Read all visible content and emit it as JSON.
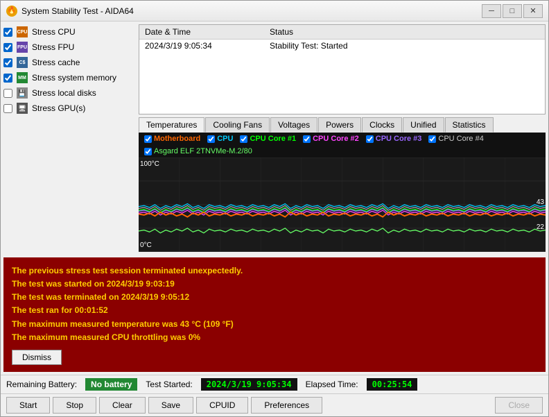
{
  "window": {
    "title": "System Stability Test - AIDA64",
    "icon": "🔥"
  },
  "titlebar": {
    "minimize": "─",
    "maximize": "□",
    "close": "✕"
  },
  "checkboxes": [
    {
      "id": "stress-cpu",
      "label": "Stress CPU",
      "checked": true,
      "iconColor": "#cc6600",
      "iconText": "CPU"
    },
    {
      "id": "stress-fpu",
      "label": "Stress FPU",
      "checked": true,
      "iconColor": "#6644aa",
      "iconText": "FPU"
    },
    {
      "id": "stress-cache",
      "label": "Stress cache",
      "checked": true,
      "iconColor": "#336699",
      "iconText": "C$"
    },
    {
      "id": "stress-mem",
      "label": "Stress system memory",
      "checked": true,
      "iconColor": "#228833",
      "iconText": "MEM"
    },
    {
      "id": "stress-disk",
      "label": "Stress local disks",
      "checked": false,
      "iconColor": "#888",
      "iconText": "💾"
    },
    {
      "id": "stress-gpu",
      "label": "Stress GPU(s)",
      "checked": false,
      "iconColor": "#555",
      "iconText": "GPU"
    }
  ],
  "log": {
    "headers": [
      "Date & Time",
      "Status"
    ],
    "rows": [
      {
        "datetime": "2024/3/19 9:05:34",
        "status": "Stability Test: Started"
      }
    ]
  },
  "tabs": [
    {
      "id": "temperatures",
      "label": "Temperatures",
      "active": true
    },
    {
      "id": "cooling-fans",
      "label": "Cooling Fans",
      "active": false
    },
    {
      "id": "voltages",
      "label": "Voltages",
      "active": false
    },
    {
      "id": "powers",
      "label": "Powers",
      "active": false
    },
    {
      "id": "clocks",
      "label": "Clocks",
      "active": false
    },
    {
      "id": "unified",
      "label": "Unified",
      "active": false
    },
    {
      "id": "statistics",
      "label": "Statistics",
      "active": false
    }
  ],
  "legend": {
    "row1": [
      {
        "id": "mb",
        "label": "Motherboard",
        "color": "#ff6600",
        "checked": true
      },
      {
        "id": "cpu",
        "label": "CPU",
        "color": "#00ccff",
        "checked": true
      },
      {
        "id": "core1",
        "label": "CPU Core #1",
        "color": "#00ff00",
        "checked": true
      },
      {
        "id": "core2",
        "label": "CPU Core #2",
        "color": "#ff00ff",
        "checked": true
      },
      {
        "id": "core3",
        "label": "CPU Core #3",
        "color": "#9966ff",
        "checked": true
      },
      {
        "id": "core4",
        "label": "CPU Core #4",
        "color": "#cccccc",
        "checked": true
      }
    ],
    "row2": [
      {
        "id": "nvme",
        "label": "Asgard ELF 2TNVMe-M.2/80",
        "color": "#66ff66",
        "checked": true
      }
    ]
  },
  "chart": {
    "y_max": "100°C",
    "y_min": "0°C",
    "value1": "43",
    "value2": "22"
  },
  "error": {
    "lines": [
      "The previous stress test session terminated unexpectedly.",
      "The test was started on 2024/3/19 9:03:19",
      "The test was terminated on 2024/3/19 9:05:12",
      "The test ran for 00:01:52",
      "The maximum measured temperature was 43 °C (109 °F)",
      "The maximum measured CPU throttling was 0%"
    ],
    "dismiss": "Dismiss"
  },
  "statusbar": {
    "remaining_battery_label": "Remaining Battery:",
    "no_battery": "No battery",
    "test_started_label": "Test Started:",
    "test_started_value": "2024/3/19 9:05:34",
    "elapsed_label": "Elapsed Time:",
    "elapsed_value": "00:25:54"
  },
  "bottombar": {
    "start": "Start",
    "stop": "Stop",
    "clear": "Clear",
    "save": "Save",
    "cpuid": "CPUID",
    "preferences": "Preferences",
    "close": "Close"
  }
}
